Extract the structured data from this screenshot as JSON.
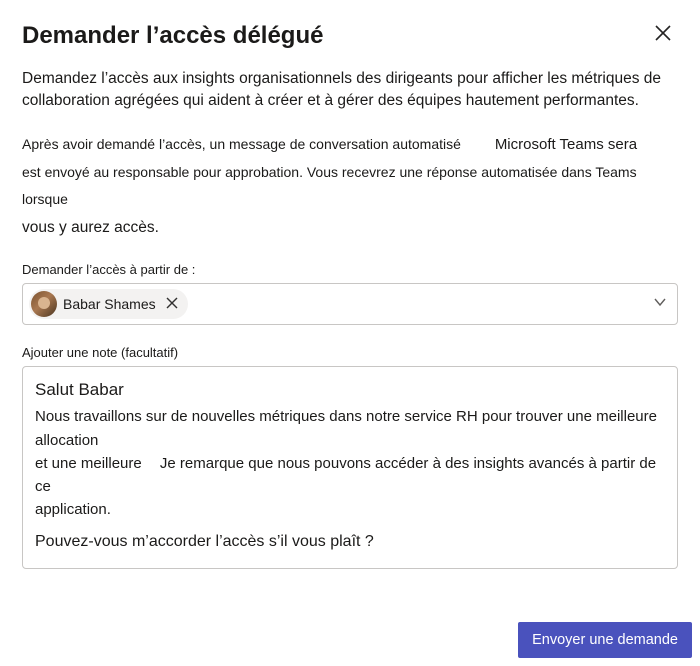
{
  "dialog": {
    "title": "Demander l’accès délégué",
    "intro": "Demandez l’accès aux insights organisationnels des dirigeants pour afficher les métriques de collaboration agrégées qui aident à créer et à gérer des équipes hautement performantes.",
    "desc_line1a": "Après avoir demandé l’accès, un message de conversation automatisé",
    "desc_line1b": "Microsoft Teams sera",
    "desc_line2": "est envoyé au responsable pour approbation. Vous recevrez une réponse automatisée dans Teams lorsque",
    "desc_line3": "vous y aurez accès."
  },
  "access_from": {
    "label": "Demander l’accès à partir de :",
    "chip_name": "Babar Shames"
  },
  "note": {
    "label": "Ajouter une note (facultatif)",
    "greeting": "Salut Babar",
    "line1a": "Nous travaillons sur de nouvelles métriques dans notre service RH pour trouver une meilleure allocation",
    "line2a": "et une meilleure",
    "line2b": "Je remarque que nous pouvons accéder à des insights avancés à partir de ce",
    "line3": "application.",
    "question": "Pouvez-vous m’accorder l’accès s’il vous plaît ?"
  },
  "actions": {
    "submit": "Envoyer une demande"
  }
}
